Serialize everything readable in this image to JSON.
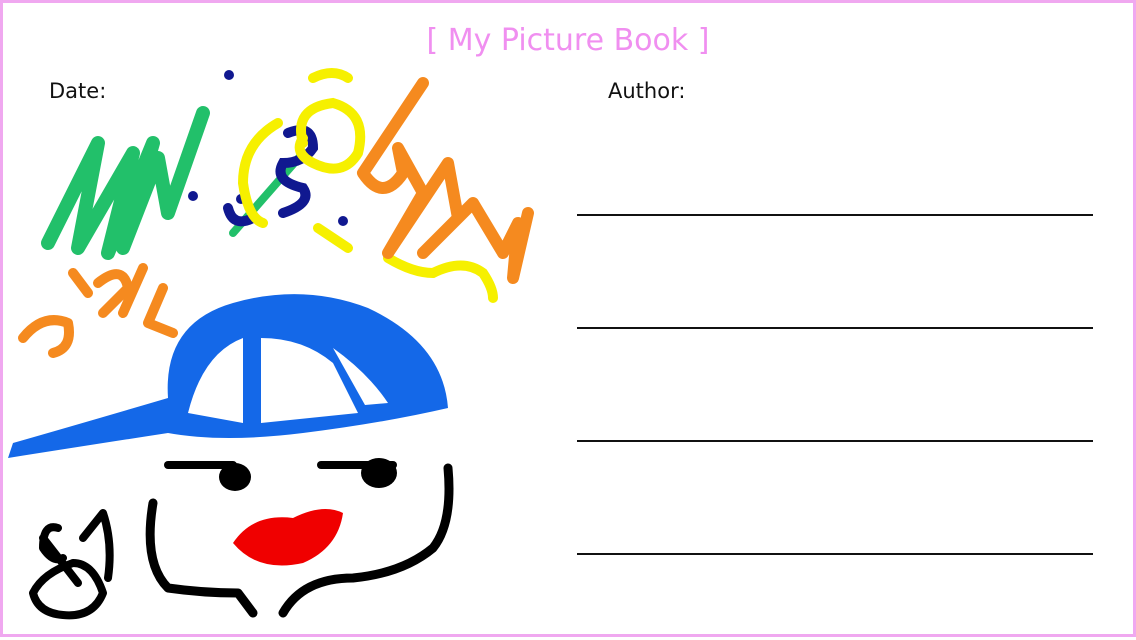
{
  "title": "[ My Picture Book ]",
  "fields": {
    "date_label": "Date:",
    "author_label": "Author:"
  },
  "writing_lines": 4,
  "colors": {
    "border": "#f0a8f0",
    "title": "#f08ff0",
    "green": "#22c06a",
    "navy": "#101890",
    "yellow": "#f6f000",
    "orange": "#f58a1f",
    "blue": "#1468e8",
    "red": "#f00000",
    "black": "#000000"
  }
}
